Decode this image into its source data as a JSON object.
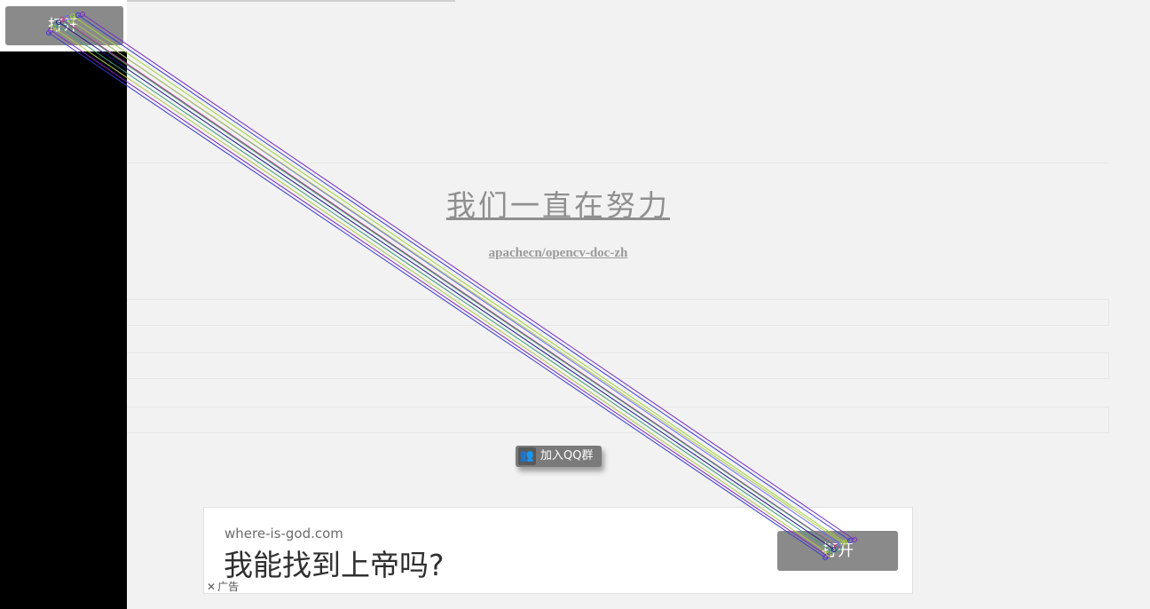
{
  "top_button": {
    "label": "打开"
  },
  "main": {
    "title": "我们一直在努力",
    "repo_link": "apachecn/opencv-doc-zh"
  },
  "qq_button": {
    "icon": "people-icon",
    "label": "加入QQ群"
  },
  "ad": {
    "domain": "where-is-god.com",
    "headline": "我能找到上帝吗?",
    "close_icon": "close-icon",
    "label": "广告",
    "button_label": "打开"
  },
  "match_line_colors": [
    "#3a3ad0",
    "#7a2bc4",
    "#b0c848",
    "#3c9a78",
    "#1a1a8a",
    "#c02c8c",
    "#6a6aff",
    "#9fd23a"
  ]
}
